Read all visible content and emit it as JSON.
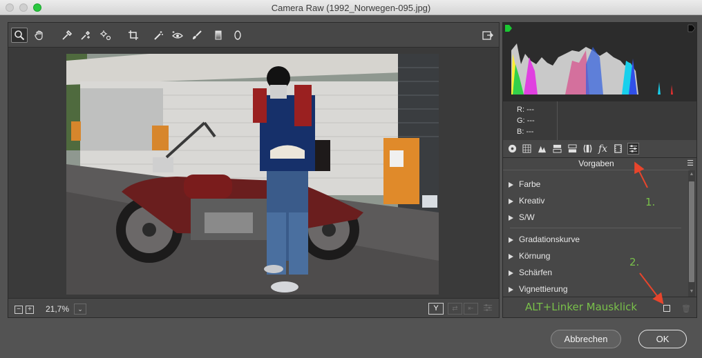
{
  "window": {
    "title": "Camera Raw (1992_Norwegen-095.jpg)"
  },
  "toolbar": {
    "tools": [
      "zoom-icon",
      "hand-icon",
      "white-balance-icon",
      "color-sampler-icon",
      "targeted-adjustment-icon",
      "crop-icon",
      "spot-removal-icon",
      "red-eye-icon",
      "adjustment-brush-icon",
      "graduated-filter-icon",
      "radial-filter-icon"
    ],
    "active_tool": "zoom-icon"
  },
  "zoom": {
    "value": "21,7%"
  },
  "view_mode": {
    "label": "Y"
  },
  "rgb": {
    "r_label": "R:",
    "g_label": "G:",
    "b_label": "B:",
    "r_value": "---",
    "g_value": "---",
    "b_value": "---"
  },
  "panel_tabs": [
    "basic-icon",
    "tone-curve-icon",
    "detail-icon",
    "hsl-icon",
    "split-toning-icon",
    "lens-icon",
    "effects-icon",
    "camera-calibration-icon",
    "presets-icon"
  ],
  "presets": {
    "header": "Vorgaben",
    "items": [
      "Farbe",
      "Kreativ",
      "S/W",
      "Gradationskurve",
      "Körnung",
      "Schärfen",
      "Vignettierung"
    ]
  },
  "annotations": {
    "step1": "1.",
    "step2": "2.",
    "instruction": "ALT+Linker Mausklick",
    "color": "#79c04a",
    "arrow_color": "#e8452c"
  },
  "buttons": {
    "cancel": "Abbrechen",
    "ok": "OK"
  }
}
